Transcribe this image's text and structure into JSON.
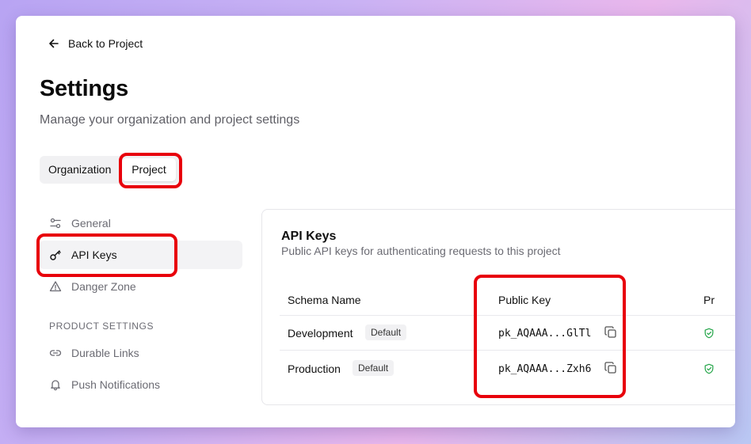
{
  "nav": {
    "back_label": "Back to Project"
  },
  "page": {
    "title": "Settings",
    "subtitle": "Manage your organization and project settings"
  },
  "tabs": [
    {
      "label": "Organization"
    },
    {
      "label": "Project",
      "selected": true
    }
  ],
  "sidebar": {
    "items": [
      {
        "label": "General",
        "icon": "sliders-icon"
      },
      {
        "label": "API Keys",
        "icon": "key-icon",
        "active": true
      },
      {
        "label": "Danger Zone",
        "icon": "warning-icon"
      }
    ],
    "section_label": "PRODUCT SETTINGS",
    "product_items": [
      {
        "label": "Durable Links",
        "icon": "link-icon"
      },
      {
        "label": "Push Notifications",
        "icon": "bell-icon"
      }
    ]
  },
  "api_keys": {
    "title": "API Keys",
    "description": "Public API keys for authenticating requests to this project",
    "columns": [
      "Schema Name",
      "Public Key",
      "Pr"
    ],
    "rows": [
      {
        "name": "Development",
        "badge": "Default",
        "key": "pk_AQAAA...GlTl"
      },
      {
        "name": "Production",
        "badge": "Default",
        "key": "pk_AQAAA...Zxh6"
      }
    ]
  },
  "colors": {
    "highlight": "#e8000b",
    "status_green": "#22a447"
  }
}
